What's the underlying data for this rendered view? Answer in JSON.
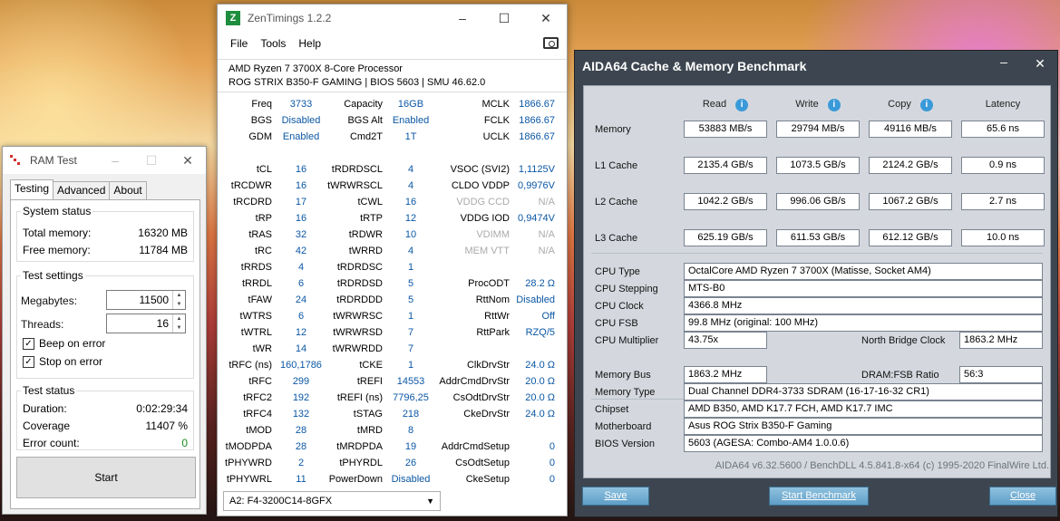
{
  "ramtest": {
    "title": "RAM Test",
    "tabs": [
      "Testing",
      "Advanced",
      "About"
    ],
    "system_status": {
      "title": "System status",
      "total_label": "Total memory:",
      "total_value": "16320 MB",
      "free_label": "Free memory:",
      "free_value": "11784 MB"
    },
    "settings": {
      "title": "Test settings",
      "megabytes_label": "Megabytes:",
      "megabytes_value": "11500",
      "threads_label": "Threads:",
      "threads_value": "16",
      "beep_label": "Beep on error",
      "stop_label": "Stop on error"
    },
    "test_status": {
      "title": "Test status",
      "duration_label": "Duration:",
      "duration_value": "0:02:29:34",
      "coverage_label": "Coverage",
      "coverage_value": "11407 %",
      "errors_label": "Error count:",
      "errors_value": "0"
    },
    "start_label": "Start"
  },
  "zen": {
    "title": "ZenTimings 1.2.2",
    "logo": "Z",
    "menu": [
      "File",
      "Tools",
      "Help"
    ],
    "cpu": "AMD Ryzen 7 3700X 8-Core Processor",
    "board": "ROG STRIX B350-F GAMING | BIOS 5603 | SMU 46.62.0",
    "col1": [
      [
        "Freq",
        "3733"
      ],
      [
        "BGS",
        "Disabled"
      ],
      [
        "GDM",
        "Enabled"
      ],
      null,
      [
        "tCL",
        "16"
      ],
      [
        "tRCDWR",
        "16"
      ],
      [
        "tRCDRD",
        "17"
      ],
      [
        "tRP",
        "16"
      ],
      [
        "tRAS",
        "32"
      ],
      [
        "tRC",
        "42"
      ],
      [
        "tRRDS",
        "4"
      ],
      [
        "tRRDL",
        "6"
      ],
      [
        "tFAW",
        "24"
      ],
      [
        "tWTRS",
        "6"
      ],
      [
        "tWTRL",
        "12"
      ],
      [
        "tWR",
        "14"
      ],
      [
        "tRFC (ns)",
        "160,1786"
      ],
      [
        "tRFC",
        "299"
      ],
      [
        "tRFC2",
        "192"
      ],
      [
        "tRFC4",
        "132"
      ],
      [
        "tMOD",
        "28"
      ],
      [
        "tMODPDA",
        "28"
      ],
      [
        "tPHYWRD",
        "2"
      ],
      [
        "tPHYWRL",
        "11"
      ]
    ],
    "col2": [
      [
        "Capacity",
        "16GB"
      ],
      [
        "BGS Alt",
        "Enabled"
      ],
      [
        "Cmd2T",
        "1T"
      ],
      null,
      [
        "tRDRDSCL",
        "4"
      ],
      [
        "tWRWRSCL",
        "4"
      ],
      [
        "tCWL",
        "16"
      ],
      [
        "tRTP",
        "12"
      ],
      [
        "tRDWR",
        "10"
      ],
      [
        "tWRRD",
        "4"
      ],
      [
        "tRDRDSC",
        "1"
      ],
      [
        "tRDRDSD",
        "5"
      ],
      [
        "tRDRDDD",
        "5"
      ],
      [
        "tWRWRSC",
        "1"
      ],
      [
        "tWRWRSD",
        "7"
      ],
      [
        "tWRWRDD",
        "7"
      ],
      [
        "tCKE",
        "1"
      ],
      [
        "tREFI",
        "14553"
      ],
      [
        "tREFI (ns)",
        "7796,25"
      ],
      [
        "tSTAG",
        "218"
      ],
      [
        "tMRD",
        "8"
      ],
      [
        "tMRDPDA",
        "19"
      ],
      [
        "tPHYRDL",
        "26"
      ],
      [
        "PowerDown",
        "Disabled"
      ]
    ],
    "col3": [
      [
        "MCLK",
        "1866.67"
      ],
      [
        "FCLK",
        "1866.67"
      ],
      [
        "UCLK",
        "1866.67"
      ],
      null,
      [
        "VSOC (SVI2)",
        "1,1125V"
      ],
      [
        "CLDO VDDP",
        "0,9976V"
      ],
      [
        "VDDG CCD",
        "N/A"
      ],
      [
        "VDDG IOD",
        "0,9474V"
      ],
      [
        "VDIMM",
        "N/A"
      ],
      [
        "MEM VTT",
        "N/A"
      ],
      null,
      [
        "ProcODT",
        "28.2 Ω"
      ],
      [
        "RttNom",
        "Disabled"
      ],
      [
        "RttWr",
        "Off"
      ],
      [
        "RttPark",
        "RZQ/5"
      ],
      null,
      [
        "ClkDrvStr",
        "24.0 Ω"
      ],
      [
        "AddrCmdDrvStr",
        "20.0 Ω"
      ],
      [
        "CsOdtDrvStr",
        "20.0 Ω"
      ],
      [
        "CkeDrvStr",
        "24.0 Ω"
      ],
      null,
      [
        "AddrCmdSetup",
        "0"
      ],
      [
        "CsOdtSetup",
        "0"
      ],
      [
        "CkeSetup",
        "0"
      ]
    ],
    "dimm": "A2: F4-3200C14-8GFX"
  },
  "aida": {
    "title": "AIDA64 Cache & Memory Benchmark",
    "headers": [
      "Read",
      "Write",
      "Copy",
      "Latency"
    ],
    "rows": [
      {
        "label": "Memory",
        "values": [
          "53883 MB/s",
          "29794 MB/s",
          "49116 MB/s",
          "65.6 ns"
        ]
      },
      {
        "label": "L1 Cache",
        "values": [
          "2135.4 GB/s",
          "1073.5 GB/s",
          "2124.2 GB/s",
          "0.9 ns"
        ]
      },
      {
        "label": "L2 Cache",
        "values": [
          "1042.2 GB/s",
          "996.06 GB/s",
          "1067.2 GB/s",
          "2.7 ns"
        ]
      },
      {
        "label": "L3 Cache",
        "values": [
          "625.19 GB/s",
          "611.53 GB/s",
          "612.12 GB/s",
          "10.0 ns"
        ]
      }
    ],
    "cpu_type_label": "CPU Type",
    "cpu_type": "OctalCore AMD Ryzen 7 3700X  (Matisse, Socket AM4)",
    "cpu_stepping_label": "CPU Stepping",
    "cpu_stepping": "MTS-B0",
    "cpu_clock_label": "CPU Clock",
    "cpu_clock": "4366.8 MHz",
    "cpu_fsb_label": "CPU FSB",
    "cpu_fsb": "99.8 MHz  (original: 100 MHz)",
    "cpu_mult_label": "CPU Multiplier",
    "cpu_mult": "43.75x",
    "nb_clock_label": "North Bridge Clock",
    "nb_clock": "1863.2 MHz",
    "mem_bus_label": "Memory Bus",
    "mem_bus": "1863.2 MHz",
    "dram_ratio_label": "DRAM:FSB Ratio",
    "dram_ratio": "56:3",
    "mem_type_label": "Memory Type",
    "mem_type": "Dual Channel DDR4-3733 SDRAM  (16-17-16-32 CR1)",
    "chipset_label": "Chipset",
    "chipset": "AMD B350, AMD K17.7 FCH, AMD K17.7 IMC",
    "mobo_label": "Motherboard",
    "mobo": "Asus ROG Strix B350-F Gaming",
    "bios_label": "BIOS Version",
    "bios": "5603  (AGESA: Combo-AM4 1.0.0.6)",
    "footer": "AIDA64 v6.32.5600 / BenchDLL 4.5.841.8-x64  (c) 1995-2020 FinalWire Ltd.",
    "save_label": "Save",
    "start_label": "Start Benchmark",
    "close_label": "Close"
  }
}
